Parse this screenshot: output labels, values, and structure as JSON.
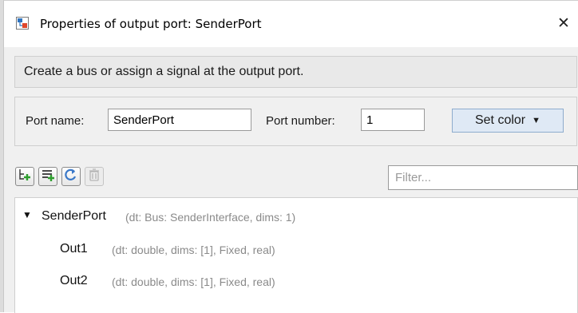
{
  "window": {
    "title": "Properties of output port: SenderPort",
    "close_label": "✕"
  },
  "description": "Create a bus or assign a signal at the output port.",
  "port": {
    "name_label": "Port name:",
    "name_value": "SenderPort",
    "number_label": "Port number:",
    "number_value": "1",
    "set_color_label": "Set color",
    "set_color_caret": "▼"
  },
  "toolbar": {
    "icons": [
      "add-element-icon",
      "add-elements-list-icon",
      "refresh-icon",
      "delete-icon"
    ],
    "filter_placeholder": "Filter..."
  },
  "tree": {
    "root": {
      "expander": "▼",
      "name": "SenderPort",
      "meta": "(dt: Bus: SenderInterface, dims: 1)"
    },
    "children": [
      {
        "name": "Out1",
        "meta": "(dt: double, dims: [1], Fixed, real)"
      },
      {
        "name": "Out2",
        "meta": "(dt: double, dims: [1], Fixed, real)"
      }
    ]
  },
  "colors": {
    "accent_button": "#dfe9f5",
    "add_green": "#2e9e2e",
    "refresh_blue": "#3a78c8"
  }
}
